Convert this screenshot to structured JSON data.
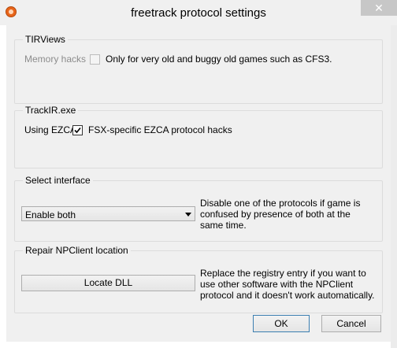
{
  "window": {
    "title": "freetrack protocol settings",
    "close_glyph": "✕"
  },
  "tirviews": {
    "title": "TIRViews",
    "memory_hacks_label": "Memory hacks",
    "checkbox_label": "Only for very old and buggy old games such as CFS3.",
    "checked": false,
    "enabled": false
  },
  "trackir": {
    "title": "TrackIR.exe",
    "using_ezca_label": "Using EZCA",
    "checkbox_label": "FSX-specific EZCA protocol hacks",
    "checked": true
  },
  "interface": {
    "title": "Select interface",
    "selected": "Enable both",
    "description": "Disable one of the protocols if game is confused by presence of both at the same time."
  },
  "npclient": {
    "title": "Repair NPClient location",
    "button_label": "Locate DLL",
    "description": "Replace the registry entry if you want to use other software with the NPClient protocol and it doesn't work automatically."
  },
  "buttons": {
    "ok": "OK",
    "cancel": "Cancel"
  },
  "colors": {
    "window_bg": "#f0f0f0",
    "titlebar_bg": "#f0f0f0",
    "close_bg": "#c7c7c7",
    "disabled_text": "#8c8c8c"
  },
  "icons": {
    "app": "freetrack-logo-icon",
    "close": "close-icon",
    "check": "check-icon",
    "dropdown": "chevron-down-icon"
  }
}
